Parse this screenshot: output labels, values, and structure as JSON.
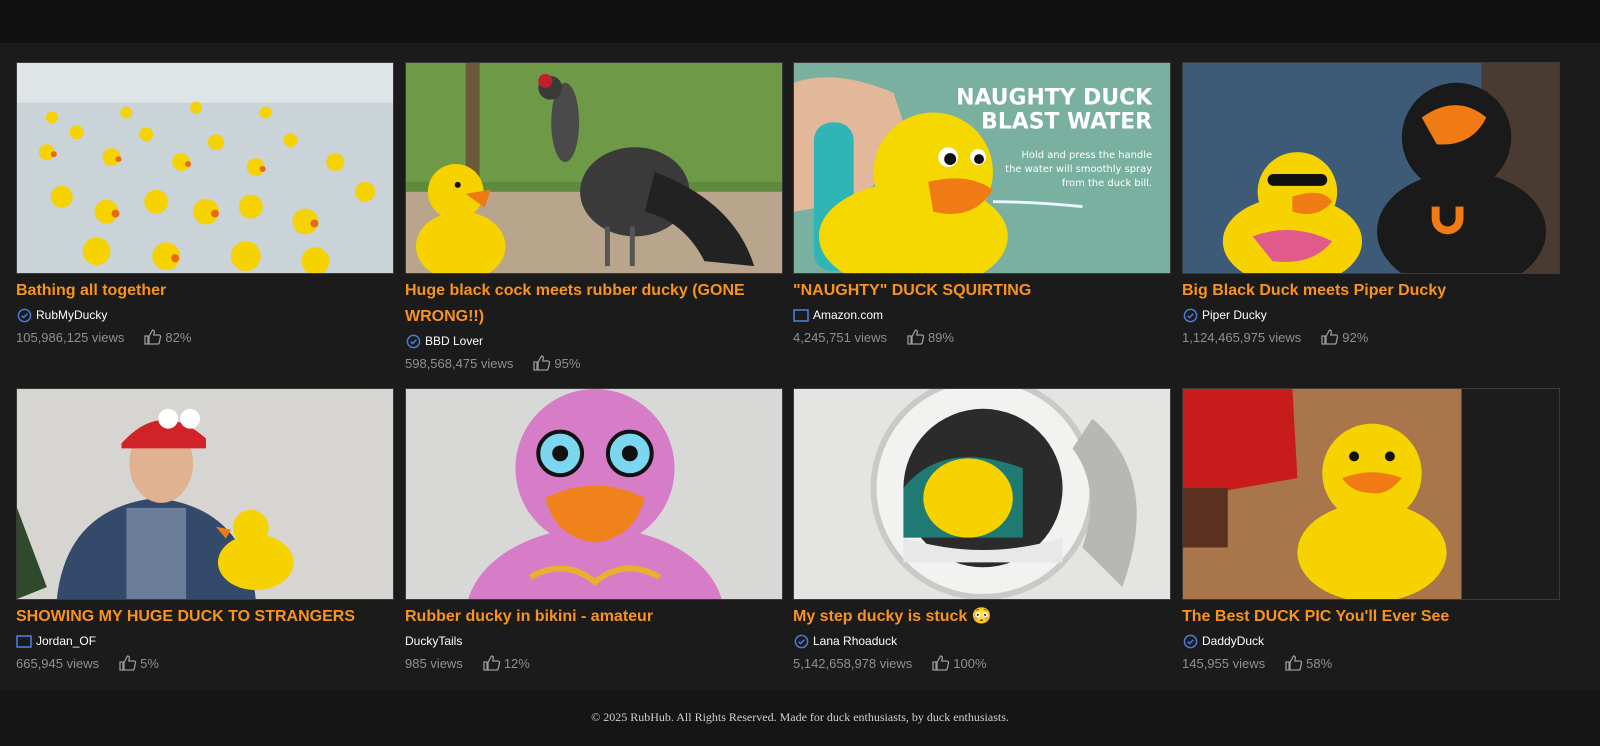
{
  "footer": {
    "copyright": "© 2025 RubHub. All Rights Reserved. Made for duck enthusiasts, by duck enthusiasts."
  },
  "colors": {
    "accent": "#f7931e",
    "verified": "#4a7bd6",
    "background": "#1b1b1b"
  },
  "videos": [
    {
      "title": "Bathing all together",
      "channel": "RubMyDucky",
      "channel_icon": "verified-badge-icon",
      "views": "105,986,125 views",
      "rating": "82%"
    },
    {
      "title": "Huge black cock meets rubber ducky (GONE WRONG!!)",
      "channel": "BBD Lover",
      "channel_icon": "verified-badge-icon",
      "views": "598,568,475 views",
      "rating": "95%"
    },
    {
      "title": "\"NAUGHTY\" DUCK SQUIRTING",
      "channel": "Amazon.com",
      "channel_icon": "channel-box-icon",
      "views": "4,245,751 views",
      "rating": "89%",
      "thumb_text": {
        "headline_1": "NAUGHTY DUCK",
        "headline_2": "BLAST WATER",
        "caption_1": "Hold and press the handle",
        "caption_2": "the water will smoothly spray",
        "caption_3": "from the duck bill."
      }
    },
    {
      "title": "Big Black Duck meets Piper Ducky",
      "channel": "Piper Ducky",
      "channel_icon": "verified-badge-icon",
      "views": "1,124,465,975 views",
      "rating": "92%"
    },
    {
      "title": "SHOWING MY HUGE DUCK TO STRANGERS",
      "channel": "Jordan_OF",
      "channel_icon": "channel-box-icon",
      "views": "665,945 views",
      "rating": "5%"
    },
    {
      "title": "Rubber ducky in bikini - amateur",
      "channel": "DuckyTails",
      "channel_icon": "none",
      "views": "985 views",
      "rating": "12%"
    },
    {
      "title": "My step ducky is stuck 😳",
      "channel": "Lana Rhoaduck",
      "channel_icon": "verified-badge-icon",
      "views": "5,142,658,978 views",
      "rating": "100%"
    },
    {
      "title": "The Best DUCK PIC You'll Ever See",
      "channel": "DaddyDuck",
      "channel_icon": "verified-badge-icon",
      "views": "145,955 views",
      "rating": "58%"
    }
  ]
}
